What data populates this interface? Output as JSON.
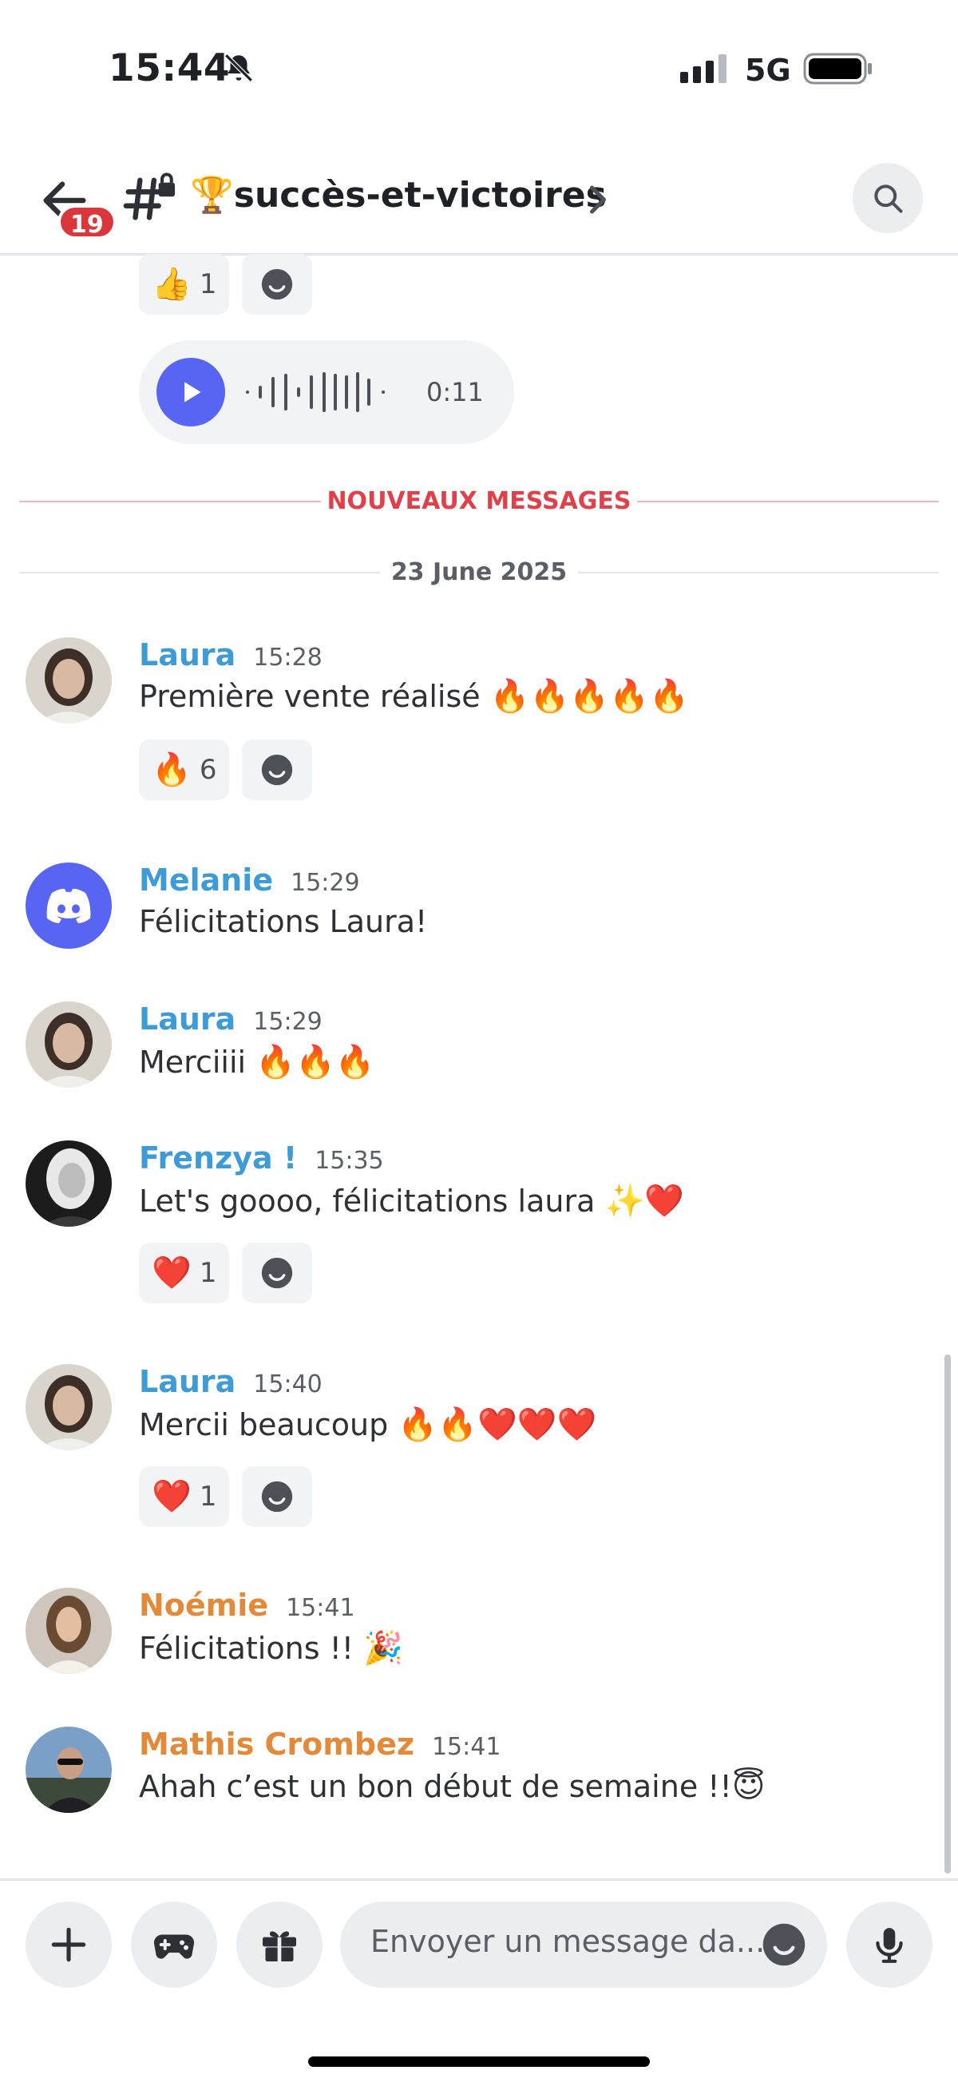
{
  "status_bar": {
    "time": "15:44",
    "network": "5G"
  },
  "header": {
    "back_badge": "19",
    "channel_name": "🏆succès-et-victoires"
  },
  "top_reaction": {
    "emoji": "👍",
    "count": "1"
  },
  "voice_message": {
    "duration": "0:11"
  },
  "new_messages_label": "NOUVEAUX MESSAGES",
  "date_label": "23 June 2025",
  "messages": [
    {
      "author": "Laura",
      "time": "15:28",
      "text": "Première vente réalisé ",
      "emoji": "🔥🔥🔥🔥🔥",
      "reaction": {
        "emoji": "🔥",
        "count": "6"
      }
    },
    {
      "author": "Melanie",
      "time": "15:29",
      "text": "Félicitations Laura!"
    },
    {
      "author": "Laura",
      "time": "15:29",
      "text": "Merciiii ",
      "emoji": "🔥🔥🔥"
    },
    {
      "author": "Frenzya !",
      "time": "15:35",
      "text": "Let's goooo, félicitations laura ",
      "emoji": "✨❤️",
      "reaction": {
        "emoji": "❤️",
        "count": "1"
      }
    },
    {
      "author": "Laura",
      "time": "15:40",
      "text": "Mercii beaucoup ",
      "emoji": "🔥🔥❤️❤️❤️",
      "reaction": {
        "emoji": "❤️",
        "count": "1"
      }
    },
    {
      "author": "Noémie",
      "time": "15:41",
      "text": "Félicitations !! ",
      "emoji": "🎉"
    },
    {
      "author": "Mathis Crombez",
      "time": "15:41",
      "text": "Ahah c’est un bon début de semaine !!",
      "emoji": "😇"
    }
  ],
  "composer": {
    "placeholder": "Envoyer un message da..."
  },
  "colors": {
    "accent": "#5865f2",
    "mention_red": "#da373c",
    "author_blue": "#3e9bd6",
    "author_orange": "#e38a3a"
  },
  "icons": [
    "bell-off-icon",
    "signal-icon",
    "battery-icon",
    "back-arrow-icon",
    "hash-lock-icon",
    "chevron-right-icon",
    "search-icon",
    "add-reaction-icon",
    "play-icon",
    "plus-icon",
    "gamepad-icon",
    "gift-icon",
    "emoji-icon",
    "microphone-icon"
  ]
}
